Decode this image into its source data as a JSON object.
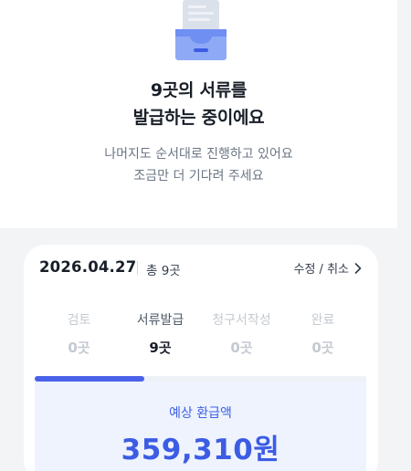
{
  "header": {
    "title_line1": "9곳의 서류를",
    "title_line2": "발급하는 중이에요",
    "sub_line1": "나머지도 순서대로 진행하고 있어요",
    "sub_line2": "조금만 더 기다려 주세요",
    "illustration_icon": "document-inbox-icon"
  },
  "card": {
    "date": "2026.04.27",
    "total": "총 9곳",
    "edit_link": "수정 / 취소",
    "steps": [
      {
        "label": "검토",
        "count": "0곳",
        "active": false
      },
      {
        "label": "서류발급",
        "count": "9곳",
        "active": true
      },
      {
        "label": "청구서작성",
        "count": "0곳",
        "active": false
      },
      {
        "label": "완료",
        "count": "0곳",
        "active": false
      }
    ],
    "progress_fraction": 0.33,
    "refund_label": "예상 환급액",
    "refund_amount": "359,310원"
  },
  "colors": {
    "accent": "#3c5ce4",
    "progress": "#4a62e9",
    "refund_bg": "#eef3fe",
    "muted": "#c4cad1"
  }
}
